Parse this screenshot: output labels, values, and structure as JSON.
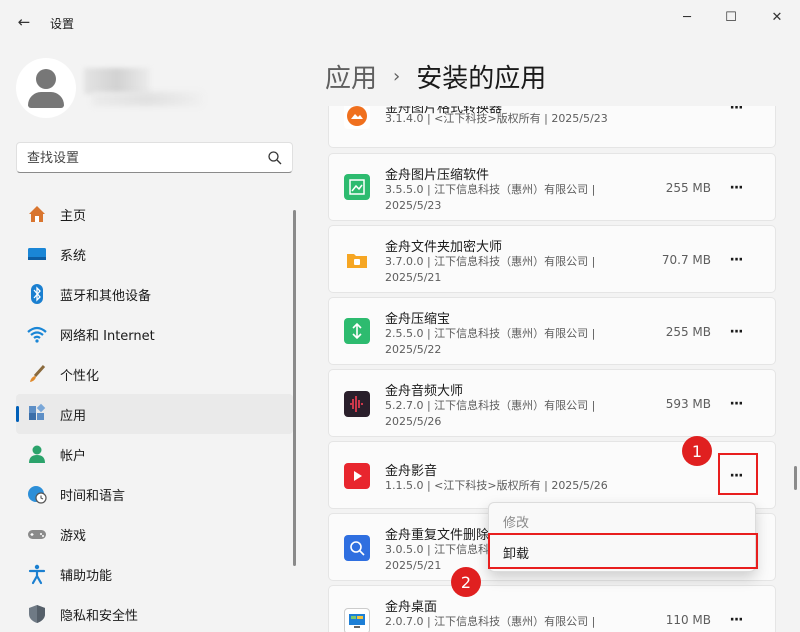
{
  "window": {
    "title": "设置",
    "back": "←",
    "minimize": "─",
    "maximize": "☐",
    "close": "✕"
  },
  "search": {
    "placeholder": "查找设置"
  },
  "sidebar": {
    "items": [
      {
        "label": "主页",
        "icon": "home-icon"
      },
      {
        "label": "系统",
        "icon": "system-icon"
      },
      {
        "label": "蓝牙和其他设备",
        "icon": "bluetooth-icon"
      },
      {
        "label": "网络和 Internet",
        "icon": "wifi-icon"
      },
      {
        "label": "个性化",
        "icon": "brush-icon"
      },
      {
        "label": "应用",
        "icon": "apps-icon",
        "active": true
      },
      {
        "label": "帐户",
        "icon": "account-icon"
      },
      {
        "label": "时间和语言",
        "icon": "clock-globe-icon"
      },
      {
        "label": "游戏",
        "icon": "gamepad-icon"
      },
      {
        "label": "辅助功能",
        "icon": "accessibility-icon"
      },
      {
        "label": "隐私和安全性",
        "icon": "shield-icon"
      }
    ]
  },
  "breadcrumb": {
    "parent": "应用",
    "separator": "›",
    "current": "安装的应用"
  },
  "apps": [
    {
      "name": "金舟图片格式转换器",
      "meta1": "3.1.4.0 | <江下科技>版权所有 | 2025/5/23",
      "meta2": "",
      "size": "",
      "more": "···"
    },
    {
      "name": "金舟图片压缩软件",
      "meta1": "3.5.5.0 | 江下信息科技（惠州）有限公司 |",
      "meta2": "2025/5/23",
      "size": "255 MB",
      "more": "···"
    },
    {
      "name": "金舟文件夹加密大师",
      "meta1": "3.7.0.0 | 江下信息科技（惠州）有限公司 |",
      "meta2": "2025/5/21",
      "size": "70.7 MB",
      "more": "···"
    },
    {
      "name": "金舟压缩宝",
      "meta1": "2.5.5.0 | 江下信息科技（惠州）有限公司 |",
      "meta2": "2025/5/22",
      "size": "255 MB",
      "more": "···"
    },
    {
      "name": "金舟音频大师",
      "meta1": "5.2.7.0 | 江下信息科技（惠州）有限公司 |",
      "meta2": "2025/5/26",
      "size": "593 MB",
      "more": "···"
    },
    {
      "name": "金舟影音",
      "meta1": "1.1.5.0 | <江下科技>版权所有 | 2025/5/26",
      "meta2": "",
      "size": "",
      "more": "···"
    },
    {
      "name": "金舟重复文件删除",
      "meta1": "3.0.5.0 | 江下信息科",
      "meta2": "2025/5/21",
      "size": "",
      "more": ""
    },
    {
      "name": "金舟桌面",
      "meta1": "2.0.7.0 | 江下信息科技（惠州）有限公司 |",
      "meta2": "",
      "size": "110 MB",
      "more": "···"
    }
  ],
  "context_menu": {
    "modify": "修改",
    "uninstall": "卸载"
  },
  "annotations": {
    "step1": "1",
    "step2": "2"
  },
  "colors": {
    "accent": "#005fb8",
    "annotation_red": "#e81e1e"
  }
}
